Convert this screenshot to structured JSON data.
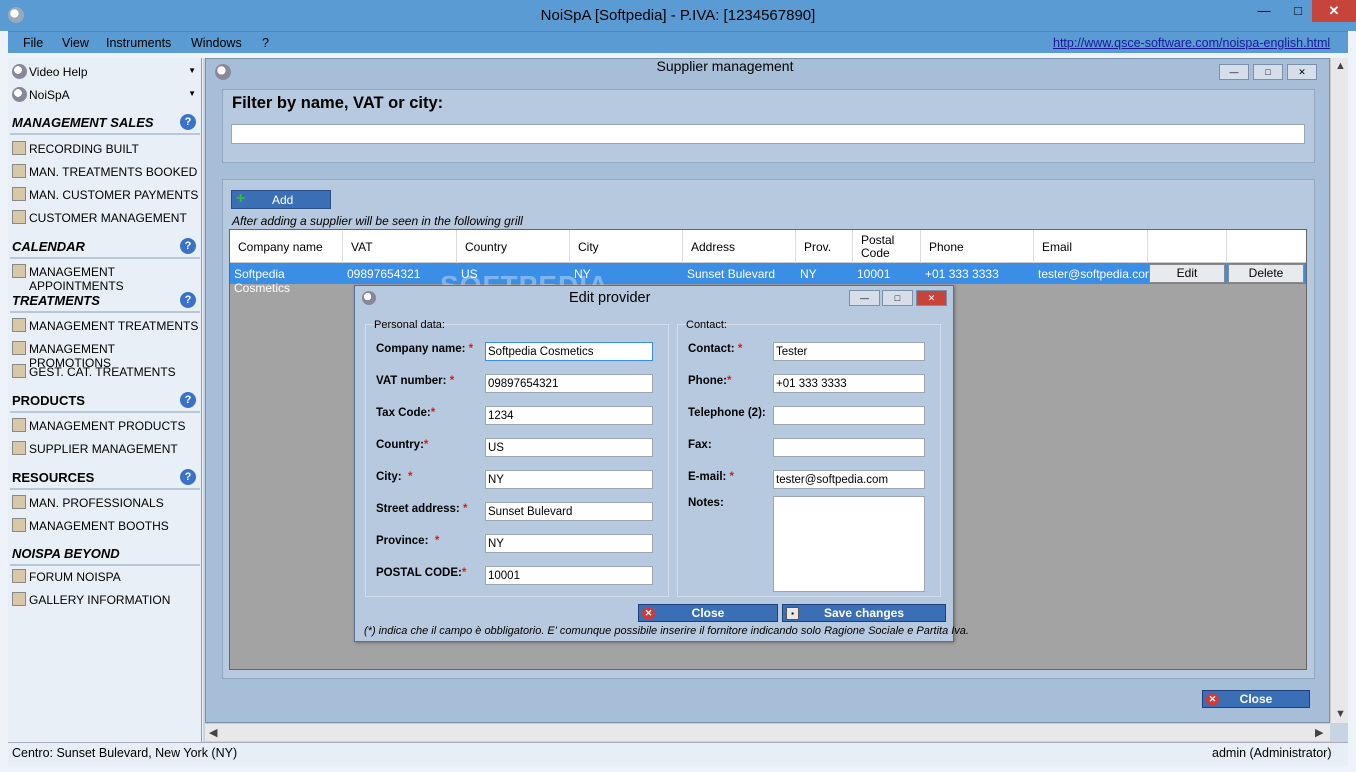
{
  "window": {
    "title": "NoiSpA  [Softpedia] - P.IVA: [1234567890]",
    "minimize": "—",
    "maximize": "□",
    "close": "✕"
  },
  "menu": {
    "items": [
      "File",
      "View",
      "Instruments",
      "Windows",
      "?"
    ],
    "url": "http://www.qsce-software.com/noispa-english.html"
  },
  "sidebar": {
    "dropdowns": [
      "Video Help",
      "NoiSpA"
    ],
    "sections": [
      {
        "title": "MANAGEMENT SALES",
        "help": "?",
        "items": [
          "RECORDING BUILT",
          "MAN. TREATMENTS BOOKED",
          "MAN. CUSTOMER PAYMENTS",
          "CUSTOMER MANAGEMENT"
        ]
      },
      {
        "title": "CALENDAR",
        "help": "?",
        "items": [
          "MANAGEMENT APPOINTMENTS"
        ]
      },
      {
        "title": "TREATMENTS",
        "help": "?",
        "items": [
          "MANAGEMENT TREATMENTS",
          "MANAGEMENT PROMOTIONS",
          "GEST. CAT. TREATMENTS"
        ]
      },
      {
        "title": "PRODUCTS",
        "help": "?",
        "items": [
          "MANAGEMENT PRODUCTS",
          "SUPPLIER MANAGEMENT"
        ]
      },
      {
        "title": "RESOURCES",
        "help": "?",
        "items": [
          "MAN. PROFESSIONALS",
          "MANAGEMENT BOOTHS"
        ]
      },
      {
        "title": "NOISPA BEYOND",
        "help": "",
        "items": [
          "FORUM NOISPA",
          "GALLERY INFORMATION"
        ]
      }
    ]
  },
  "supplier_window": {
    "title": "Supplier management",
    "filter_label": "Filter by name, VAT or city:",
    "filter_value": "",
    "add_label": "Add",
    "add_hint": "After adding a supplier will be seen in the following grill",
    "columns": [
      "Company name",
      "VAT",
      "Country",
      "City",
      "Address",
      "Prov.",
      "Postal Code",
      "Phone",
      "Email"
    ],
    "rows": [
      {
        "company": "Softpedia Cosmetics",
        "vat": "09897654321",
        "country": "US",
        "city": "NY",
        "address": "Sunset Bulevard",
        "prov": "NY",
        "postal": "10001",
        "phone": "+01 333 3333",
        "email": "tester@softpedia.com",
        "edit": "Edit",
        "delete": "Delete"
      }
    ],
    "close_label": "Close"
  },
  "edit_dialog": {
    "title": "Edit provider",
    "personal_group": "Personal data:",
    "contact_group": "Contact:",
    "personal_fields": [
      {
        "label": "Company name:",
        "value": "Softpedia Cosmetics"
      },
      {
        "label": "VAT number:",
        "value": "09897654321"
      },
      {
        "label": "Tax Code:",
        "value": "1234"
      },
      {
        "label": "Country:",
        "value": "US"
      },
      {
        "label": "City:",
        "value": "NY"
      },
      {
        "label": "Street address:",
        "value": "Sunset Bulevard"
      },
      {
        "label": "Province:",
        "value": "NY"
      },
      {
        "label": "POSTAL CODE:",
        "value": "10001"
      }
    ],
    "contact_fields": [
      {
        "label": "Contact:",
        "value": "Tester"
      },
      {
        "label": "Phone:",
        "value": "+01 333 3333"
      },
      {
        "label": "Telephone (2):",
        "value": ""
      },
      {
        "label": "Fax:",
        "value": ""
      },
      {
        "label": "E-mail:",
        "value": "tester@softpedia.com"
      }
    ],
    "notes_label": "Notes:",
    "notes_value": "",
    "required_mark": "*",
    "close_label": "Close",
    "save_label": "Save changes",
    "note": "(*) indica che il campo è obbligatorio. E' comunque possibile inserire il fornitore indicando solo Ragione Sociale e Partita Iva."
  },
  "status": {
    "left": "Centro: Sunset Bulevard,  New York (NY)",
    "right": "admin (Administrator)"
  },
  "watermark": "SOFTPEDIA",
  "colors": {
    "titlebar": "#5a9bd4",
    "selected_row": "#3a8ee6",
    "button_blue": "#3b6fb5",
    "required": "#d02020",
    "close_red": "#c7443a"
  }
}
